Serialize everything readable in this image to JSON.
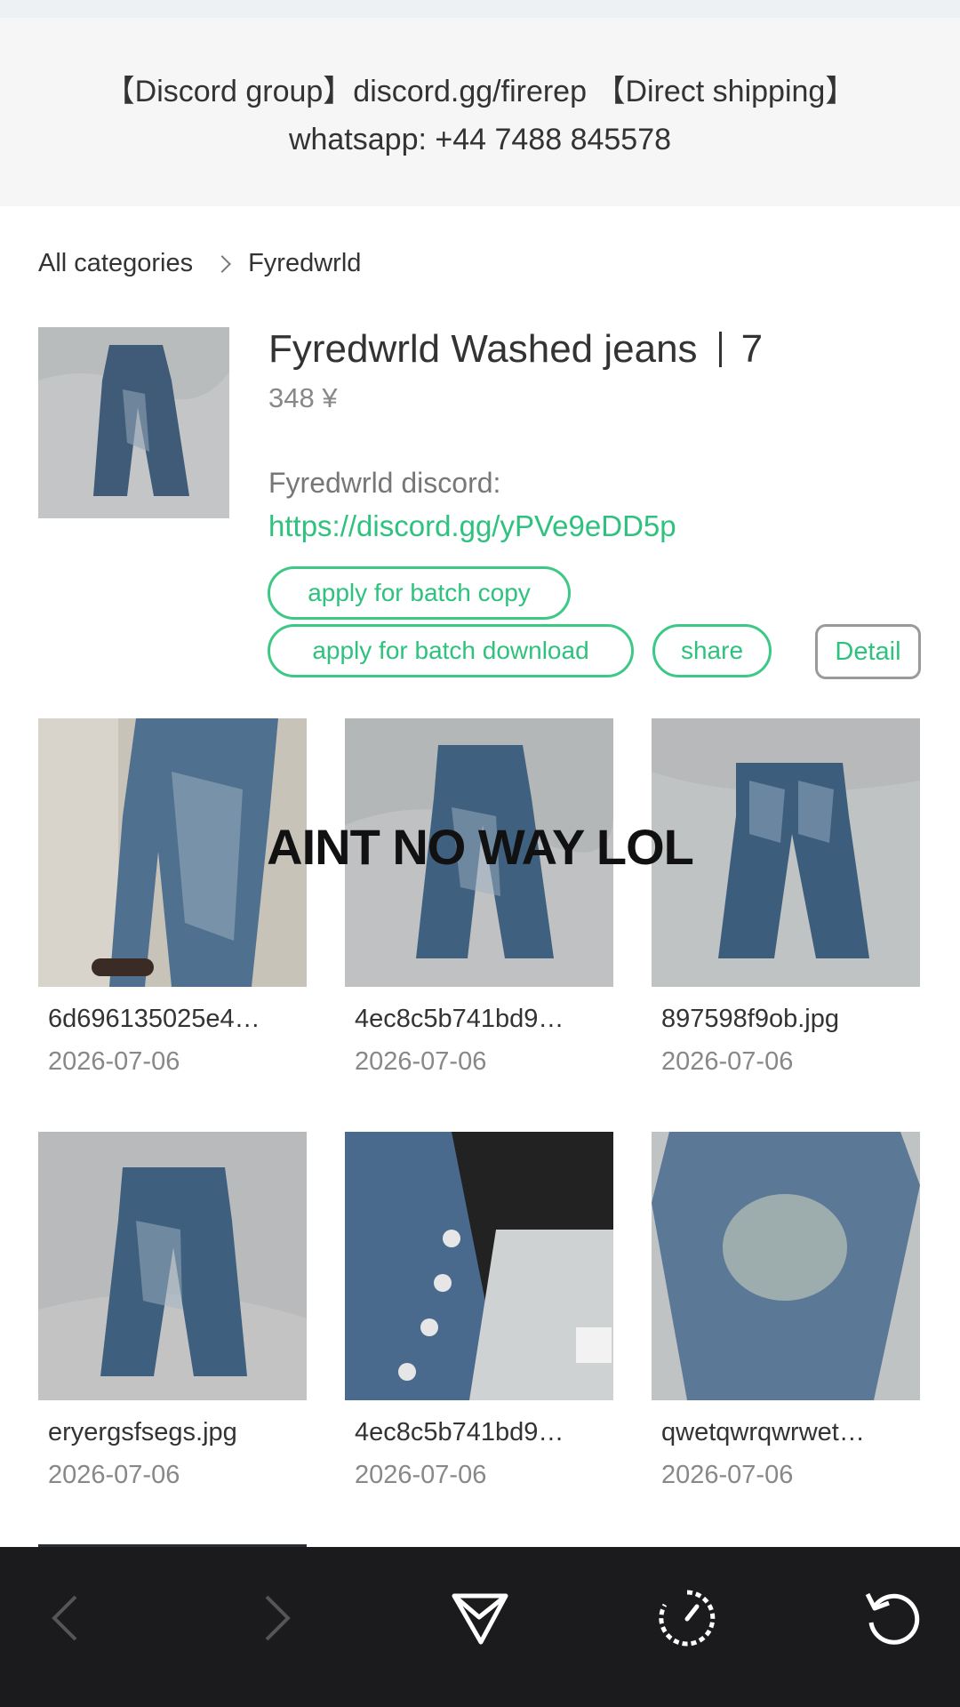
{
  "banner": {
    "line1": "【Discord group】discord.gg/firerep 【Direct shipping】",
    "line2": "whatsapp: +44 7488 845578"
  },
  "breadcrumb": {
    "root": "All categories",
    "current": "Fyredwrld"
  },
  "album": {
    "title": "Fyredwrld Washed jeans",
    "count": "7",
    "price": "348 ¥",
    "description": "Fyredwrld discord:",
    "link": "https://discord.gg/yPVe9eDD5p"
  },
  "buttons": {
    "batch_copy": "apply for batch copy",
    "batch_download": "apply for batch download",
    "share": "share",
    "detail": "Detail"
  },
  "overlay_text": "AINT NO WAY LOL",
  "images": [
    {
      "name": "6d696135025e4…",
      "date": "2026-07-06"
    },
    {
      "name": "4ec8c5b741bd9…",
      "date": "2026-07-06"
    },
    {
      "name": "897598f9ob.jpg",
      "date": "2026-07-06"
    },
    {
      "name": "eryergsfsegs.jpg",
      "date": "2026-07-06"
    },
    {
      "name": "4ec8c5b741bd9…",
      "date": "2026-07-06"
    },
    {
      "name": "qwetqwrqwrwet…",
      "date": "2026-07-06"
    }
  ],
  "nav_icons": [
    "back-arrow-icon",
    "forward-arrow-icon",
    "send-icon",
    "speed-gauge-icon",
    "reload-icon"
  ],
  "colors": {
    "accent": "#2ec27e",
    "nav_bg": "#1b1b1d"
  }
}
